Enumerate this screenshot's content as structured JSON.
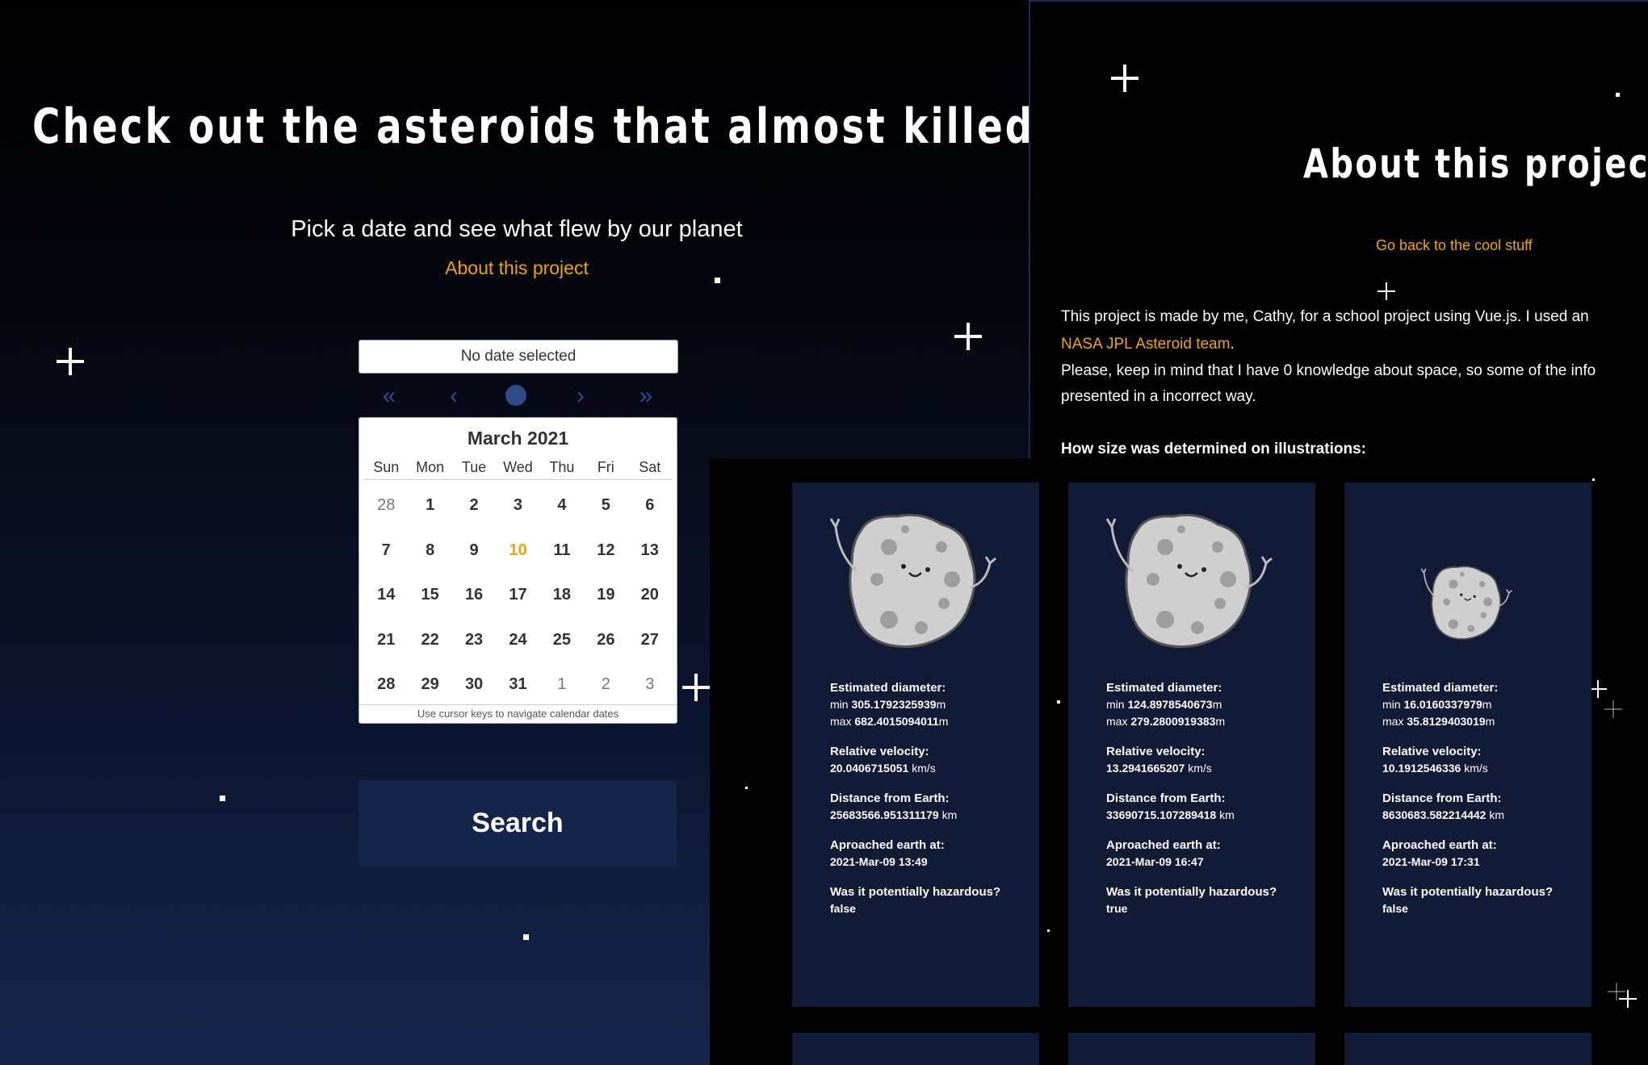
{
  "main": {
    "title": "Check out the asteroids that almost killed us",
    "subtitle": "Pick a date and see what flew by our planet",
    "about_link": "About this project",
    "date_placeholder": "No date selected",
    "search_label": "Search"
  },
  "calendar": {
    "month": "March 2021",
    "weekdays": [
      "Sun",
      "Mon",
      "Tue",
      "Wed",
      "Thu",
      "Fri",
      "Sat"
    ],
    "days": [
      "28",
      "1",
      "2",
      "3",
      "4",
      "5",
      "6",
      "7",
      "8",
      "9",
      "10",
      "11",
      "12",
      "13",
      "14",
      "15",
      "16",
      "17",
      "18",
      "19",
      "20",
      "21",
      "22",
      "23",
      "24",
      "25",
      "26",
      "27",
      "28",
      "29",
      "30",
      "31",
      "1",
      "2",
      "3"
    ],
    "today": "10",
    "hint": "Use cursor keys to navigate calendar dates"
  },
  "about": {
    "title": "About this project",
    "back_link": "Go back to the cool stuff",
    "line1": "This project is made by me, Cathy, for a school project using Vue.js. I used an",
    "nasa_link": "NASA JPL Asteroid team",
    "line2_end": ".",
    "line3": "Please, keep in mind that I have 0 knowledge about space, so some of the info",
    "line4": "presented in a incorrect way.",
    "size_heading": "How size was determined on illustrations:"
  },
  "labels": {
    "diameter": "Estimated diameter:",
    "min": "min",
    "max": "max",
    "velocity": "Relative velocity:",
    "velocity_unit": "km/s",
    "distance": "Distance from Earth:",
    "distance_unit": "km",
    "approached": "Aproached earth at:",
    "hazard": "Was it potentially hazardous?",
    "meter": "m"
  },
  "asteroids": [
    {
      "min": "305.1792325939",
      "max": "682.4015094011",
      "velocity": "20.0406715051",
      "distance": "25683566.951311179",
      "date": "2021-Mar-09 13:49",
      "hazardous": "false"
    },
    {
      "min": "124.8978540673",
      "max": "279.2800919383",
      "velocity": "13.2941665207",
      "distance": "33690715.107289418",
      "date": "2021-Mar-09 16:47",
      "hazardous": "true"
    },
    {
      "min": "16.0160337979",
      "max": "35.8129403019",
      "velocity": "10.1912546336",
      "distance": "8630683.582214442",
      "date": "2021-Mar-09 17:31",
      "hazardous": "false"
    }
  ]
}
